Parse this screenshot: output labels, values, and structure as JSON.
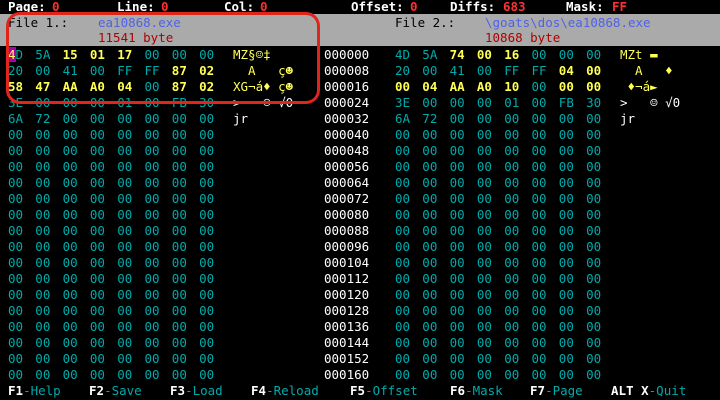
{
  "status": {
    "page_label": "Page:",
    "page_value": "0",
    "line_label": "Line:",
    "line_value": "0",
    "col_label": "Col:",
    "col_value": "0",
    "offset_label": "Offset:",
    "offset_value": "0",
    "diffs_label": "Diffs:",
    "diffs_value": "683",
    "mask_label": "Mask:",
    "mask_value": "FF"
  },
  "file1": {
    "label": "File 1.:",
    "name": "ea10868.exe",
    "size": "11541 byte"
  },
  "file2": {
    "label": "File 2.:",
    "name": "\\goats\\dos\\ea10868.exe",
    "size": "10868 byte"
  },
  "rows": [
    {
      "offset": "000000",
      "left": [
        "4D",
        "5A",
        "15",
        "01",
        "17",
        "00",
        "00",
        "00"
      ],
      "left_hl": [
        0,
        0,
        1,
        1,
        1,
        0,
        0,
        0
      ],
      "left_ascii": "MZ§☺‡",
      "right": [
        "4D",
        "5A",
        "74",
        "00",
        "16",
        "00",
        "00",
        "00"
      ],
      "right_hl": [
        0,
        0,
        1,
        1,
        1,
        0,
        0,
        0
      ],
      "right_ascii": "MZt ▬"
    },
    {
      "offset": "000008",
      "left": [
        "20",
        "00",
        "41",
        "00",
        "FF",
        "FF",
        "87",
        "02"
      ],
      "left_hl": [
        0,
        0,
        0,
        0,
        0,
        0,
        1,
        1
      ],
      "left_ascii": "  A   ç☻",
      "right": [
        "20",
        "00",
        "41",
        "00",
        "FF",
        "FF",
        "04",
        "00"
      ],
      "right_hl": [
        0,
        0,
        0,
        0,
        0,
        0,
        1,
        1
      ],
      "right_ascii": "  A   ♦"
    },
    {
      "offset": "000016",
      "left": [
        "58",
        "47",
        "AA",
        "A0",
        "04",
        "00",
        "87",
        "02"
      ],
      "left_hl": [
        1,
        1,
        1,
        1,
        1,
        0,
        1,
        1
      ],
      "left_ascii": "XG¬á♦ ç☻",
      "right": [
        "00",
        "04",
        "AA",
        "A0",
        "10",
        "00",
        "00",
        "00"
      ],
      "right_hl": [
        1,
        1,
        1,
        1,
        1,
        0,
        1,
        1
      ],
      "right_ascii": " ♦¬á►"
    },
    {
      "offset": "000024",
      "left": [
        "3E",
        "00",
        "00",
        "00",
        "01",
        "00",
        "FB",
        "30"
      ],
      "left_hl": [
        0,
        0,
        0,
        0,
        0,
        0,
        0,
        0
      ],
      "left_ascii": ">   ☺ √0",
      "right": [
        "3E",
        "00",
        "00",
        "00",
        "01",
        "00",
        "FB",
        "30"
      ],
      "right_hl": [
        0,
        0,
        0,
        0,
        0,
        0,
        0,
        0
      ],
      "right_ascii": ">   ☺ √0"
    },
    {
      "offset": "000032",
      "left": [
        "6A",
        "72",
        "00",
        "00",
        "00",
        "00",
        "00",
        "00"
      ],
      "left_hl": [
        0,
        0,
        0,
        0,
        0,
        0,
        0,
        0
      ],
      "left_ascii": "jr",
      "right": [
        "6A",
        "72",
        "00",
        "00",
        "00",
        "00",
        "00",
        "00"
      ],
      "right_hl": [
        0,
        0,
        0,
        0,
        0,
        0,
        0,
        0
      ],
      "right_ascii": "jr"
    },
    {
      "offset": "000040"
    },
    {
      "offset": "000048"
    },
    {
      "offset": "000056"
    },
    {
      "offset": "000064"
    },
    {
      "offset": "000072"
    },
    {
      "offset": "000080"
    },
    {
      "offset": "000088"
    },
    {
      "offset": "000096"
    },
    {
      "offset": "000104"
    },
    {
      "offset": "000112"
    },
    {
      "offset": "000120"
    },
    {
      "offset": "000128"
    },
    {
      "offset": "000136"
    },
    {
      "offset": "000144"
    },
    {
      "offset": "000152"
    },
    {
      "offset": "000160"
    }
  ],
  "fkeys": [
    {
      "key": "F1",
      "desc": "-Help"
    },
    {
      "key": "F2",
      "desc": "-Save"
    },
    {
      "key": "F3",
      "desc": "-Load"
    },
    {
      "key": "F4",
      "desc": "-Reload"
    },
    {
      "key": "F5",
      "desc": "-Offset"
    },
    {
      "key": "F6",
      "desc": "-Mask"
    },
    {
      "key": "F7",
      "desc": "-Page"
    },
    {
      "key": "ALT X",
      "desc": "-Quit"
    }
  ],
  "colors": {
    "accent_red": "#ff3030",
    "cyan": "#00aaaa",
    "yellow": "#ffff55",
    "header_gray": "#aaaaaa",
    "annotation": "#e0251b"
  }
}
